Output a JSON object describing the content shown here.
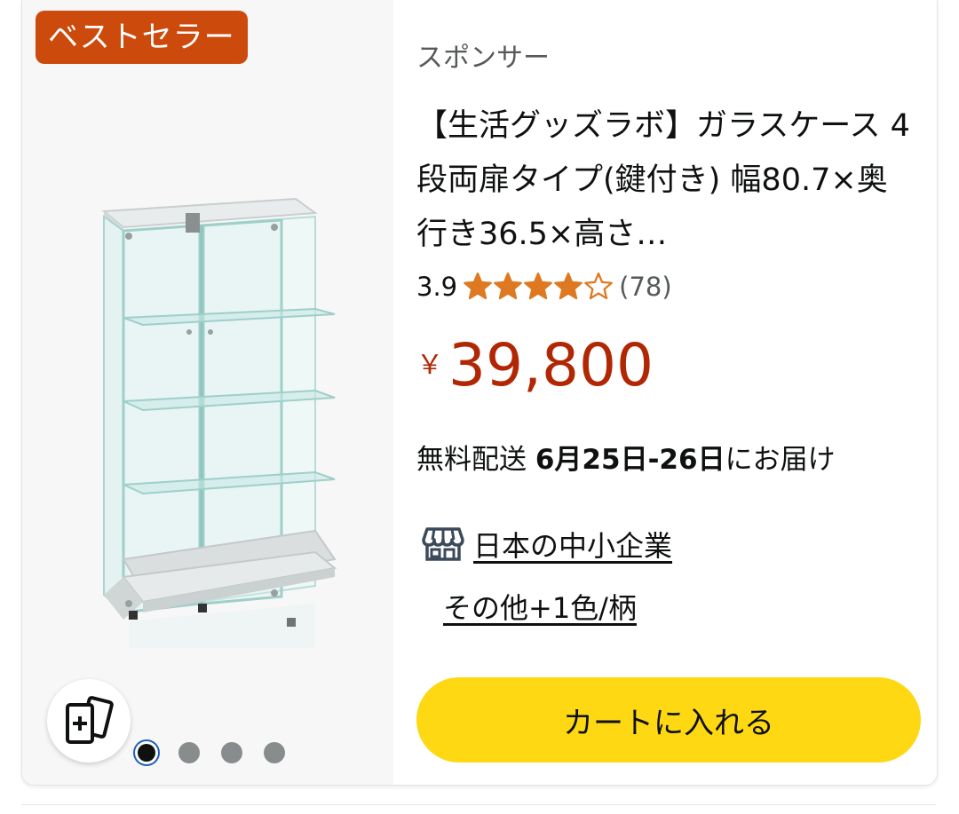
{
  "badge": {
    "label": "ベストセラー"
  },
  "product": {
    "sponsor_label": "スポンサー",
    "title": "【生活グッズラボ】ガラスケース 4段両扉タイプ(鍵付き) 幅80.7×奥行き36.5×高さ…",
    "rating": {
      "value": "3.9",
      "stars": 3.9,
      "count": "(78)"
    },
    "price": {
      "currency": "￥",
      "amount": "39,800"
    },
    "delivery": {
      "prefix": "無料配送 ",
      "dates": "6月25日-26日",
      "suffix": "にお届け"
    },
    "sme_label": "日本の中小企業",
    "variants_label": "その他+1色/柄",
    "cart_button": "カートに入れる"
  },
  "carousel": {
    "total": 4,
    "active": 0
  },
  "icons": {
    "similar": "similar-items-icon",
    "store": "storefront-icon"
  },
  "colors": {
    "badge": "#cc4a0b",
    "price": "#b12704",
    "star": "#de7921",
    "cart": "#ffd814"
  }
}
